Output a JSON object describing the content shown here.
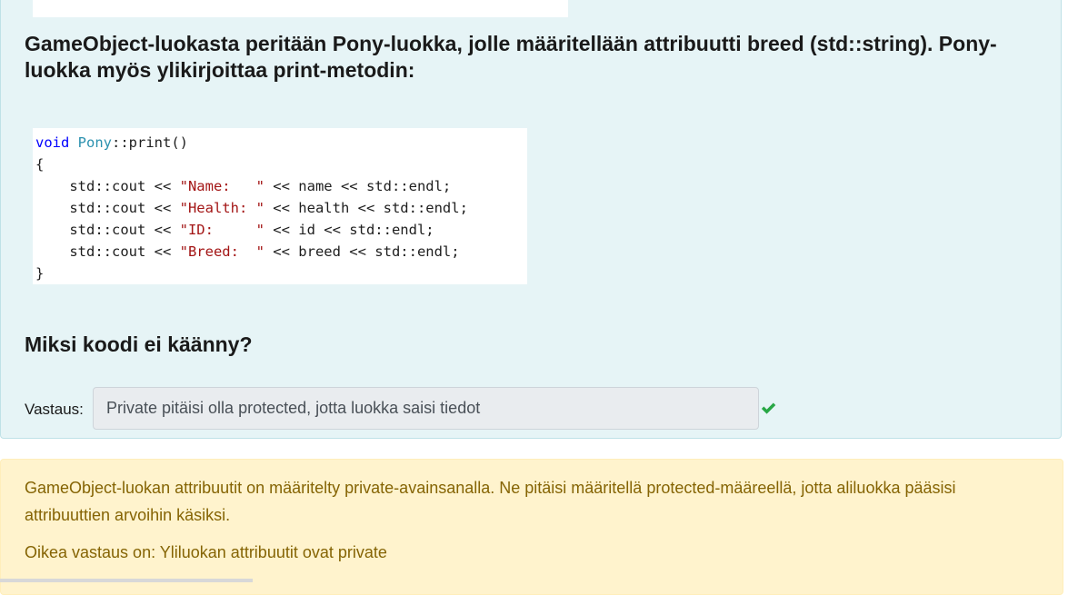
{
  "question": {
    "text": "GameObject-luokasta peritään Pony-luokka, jolle määritellään attribuutti breed (std::string). Pony-luokka myös ylikirjoittaa print-metodin:",
    "code": {
      "lines": [
        [
          {
            "t": "void",
            "c": "kw"
          },
          {
            "t": " "
          },
          {
            "t": "Pony",
            "c": "ty"
          },
          {
            "t": "::print()"
          }
        ],
        [
          {
            "t": "{"
          }
        ],
        [
          {
            "t": "    std::cout << "
          },
          {
            "t": "\"Name:   \"",
            "c": "st"
          },
          {
            "t": " << name << std::endl;"
          }
        ],
        [
          {
            "t": "    std::cout << "
          },
          {
            "t": "\"Health: \"",
            "c": "st"
          },
          {
            "t": " << health << std::endl;"
          }
        ],
        [
          {
            "t": "    std::cout << "
          },
          {
            "t": "\"ID:     \"",
            "c": "st"
          },
          {
            "t": " << id << std::endl;"
          }
        ],
        [
          {
            "t": "    std::cout << "
          },
          {
            "t": "\"Breed:  \"",
            "c": "st"
          },
          {
            "t": " << breed << std::endl;"
          }
        ],
        [
          {
            "t": "}"
          }
        ]
      ]
    },
    "sub_question": "Miksi koodi ei käänny?",
    "answer_label": "Vastaus:",
    "answer_value": "Private pitäisi olla protected, jotta luokka saisi tiedot",
    "answer_status_icon": "check-icon",
    "status_color": "#28a745"
  },
  "feedback": {
    "explanation": "GameObject-luokan attribuutit on määritelty private-avainsanalla. Ne pitäisi määritellä protected-määreellä, jotta aliluokka pääsisi attribuuttien arvoihin käsiksi.",
    "correct_answer": "Oikea vastaus on: Yliluokan attribuutit ovat private"
  }
}
